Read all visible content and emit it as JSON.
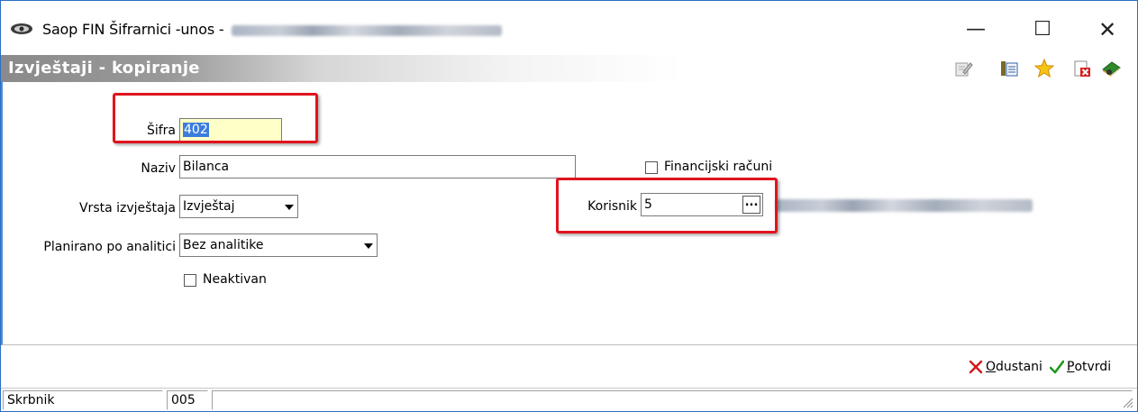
{
  "window": {
    "title": "Saop FIN Šifrarnici -unos -",
    "controls": {
      "minimize": "—",
      "maximize": "☐",
      "close": "✕"
    }
  },
  "header": {
    "title": "Izvještaji - kopiranje",
    "toolbar_icons": [
      "edit-icon",
      "list-view-icon",
      "star-icon",
      "delete-icon",
      "book-help-icon"
    ]
  },
  "form": {
    "sifra": {
      "label": "Šifra",
      "value": "402"
    },
    "naziv": {
      "label": "Naziv",
      "value": "Bilanca"
    },
    "vrsta": {
      "label": "Vrsta izvještaja",
      "value": "Izvještaj"
    },
    "planirano": {
      "label": "Planirano po analitici",
      "value": "Bez analitike"
    },
    "neaktivan": {
      "label": "Neaktivan",
      "checked": false
    },
    "financijski": {
      "label": "Financijski računi",
      "checked": false
    },
    "korisnik": {
      "label": "Korisnik",
      "value": "5",
      "button": "..."
    }
  },
  "actions": {
    "cancel": {
      "label_u": "O",
      "label_rest": "dustani"
    },
    "confirm": {
      "label_u": "P",
      "label_rest": "otvrdi"
    }
  },
  "status": {
    "cell1": "Skrbnik",
    "cell2": "005",
    "cell3": ""
  },
  "colors": {
    "highlight_box": "#e0141e",
    "selection": "#3b7ddd",
    "header_band": "#9a9a9a",
    "input_highlight": "#ffffc8"
  }
}
